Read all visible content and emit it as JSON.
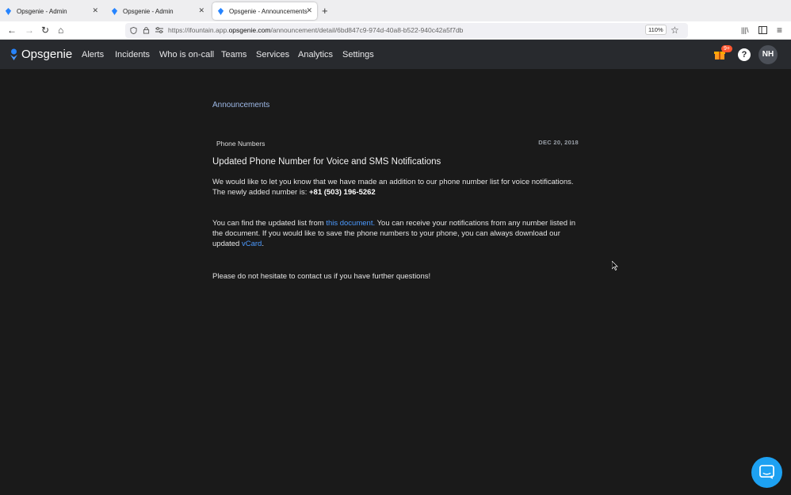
{
  "browser": {
    "tabs": [
      {
        "title": "Opsgenie - Admin",
        "active": false
      },
      {
        "title": "Opsgenie - Admin",
        "active": false
      },
      {
        "title": "Opsgenie - Announcements",
        "active": true
      }
    ],
    "url_prefix": "https://ifountain.app.",
    "url_host": "opsgenie.com",
    "url_path": "/announcement/detail/6bd847c9-974d-40a8-b522-940c42a5f7db",
    "zoom": "110%"
  },
  "appnav": {
    "logo": "Opsgenie",
    "items": [
      "Alerts",
      "Incidents",
      "Who is on-call",
      "Teams",
      "Services",
      "Analytics",
      "Settings"
    ],
    "badge": "9+",
    "help": "?",
    "avatar": "NH"
  },
  "announcement": {
    "breadcrumb": "Announcements",
    "category": "Phone Numbers",
    "date": "DEC 20, 2018",
    "title": "Updated Phone Number for Voice and SMS Notifications",
    "p1_text": "We would like to let you know that we have made an addition to our phone number list for voice notifications. The newly added number is: ",
    "p1_number": "+81 (503) 196-5262",
    "p2_a": "You can find the updated list from ",
    "p2_link": "this document.",
    "p2_b": " You can receive your notifications from any number listed in the document. If you would like to save the phone numbers to your phone, you can always download our updated ",
    "p2_vcard": "vCard",
    "p2_end": ".",
    "p3": "Please do not hesitate to contact us if you have further questions!"
  },
  "colors": {
    "accent": "#4c9aff",
    "navbar": "#282a2e",
    "background": "#1a1a1a",
    "chat": "#1da1f2"
  }
}
